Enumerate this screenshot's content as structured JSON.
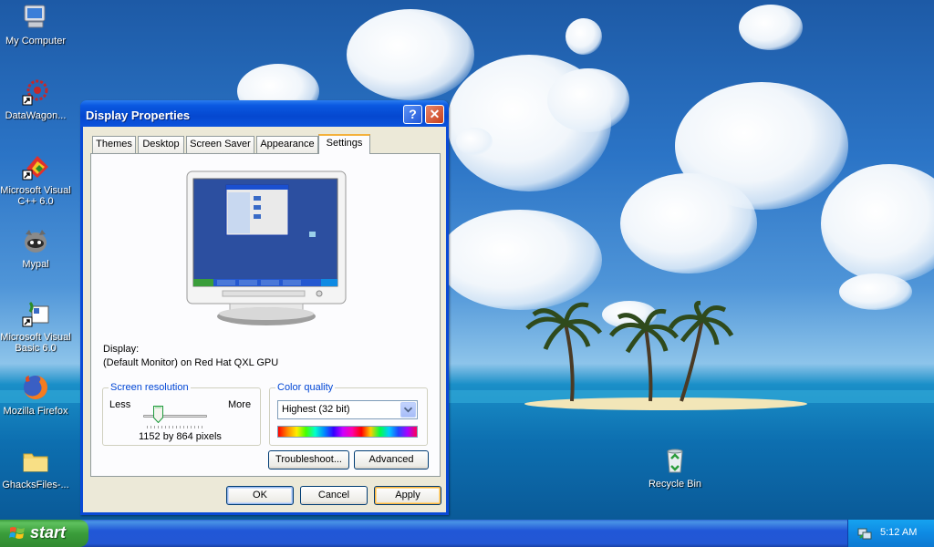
{
  "desktop": {
    "icons": [
      {
        "label": "My Computer",
        "icon": "my-computer-icon"
      },
      {
        "label": "DataWagon...",
        "icon": "datawagon-shortcut-icon"
      },
      {
        "label": "Microsoft Visual C++ 6.0",
        "icon": "visual-cpp-shortcut-icon"
      },
      {
        "label": "Mypal",
        "icon": "mypal-icon"
      },
      {
        "label": "Microsoft Visual Basic 6.0",
        "icon": "visual-basic-shortcut-icon"
      },
      {
        "label": "Mozilla Firefox",
        "icon": "firefox-icon"
      },
      {
        "label": "GhacksFiles-...",
        "icon": "folder-icon"
      },
      {
        "label": "Recycle Bin",
        "icon": "recycle-bin-icon"
      }
    ]
  },
  "dialog": {
    "title": "Display Properties",
    "help_glyph": "?",
    "close_glyph": "✕",
    "tabs": [
      "Themes",
      "Desktop",
      "Screen Saver",
      "Appearance",
      "Settings"
    ],
    "active_tab": "Settings",
    "display_label": "Display:",
    "display_value": "(Default Monitor) on Red Hat QXL GPU",
    "resolution": {
      "group_label": "Screen resolution",
      "less": "Less",
      "more": "More",
      "value_text": "1152 by 864 pixels",
      "slider_level": 0.2
    },
    "color_quality": {
      "group_label": "Color quality",
      "selected": "Highest (32 bit)"
    },
    "buttons": {
      "troubleshoot": "Troubleshoot...",
      "advanced": "Advanced",
      "ok": "OK",
      "cancel": "Cancel",
      "apply": "Apply"
    }
  },
  "taskbar": {
    "start_label": "start",
    "clock": "5:12 AM"
  },
  "colors": {
    "title_bar": "#0a58e0",
    "dialog_face": "#ece9d8",
    "start_green": "#3a9d3a",
    "taskbar_blue": "#2257d4",
    "group_label_blue": "#0046d5"
  }
}
